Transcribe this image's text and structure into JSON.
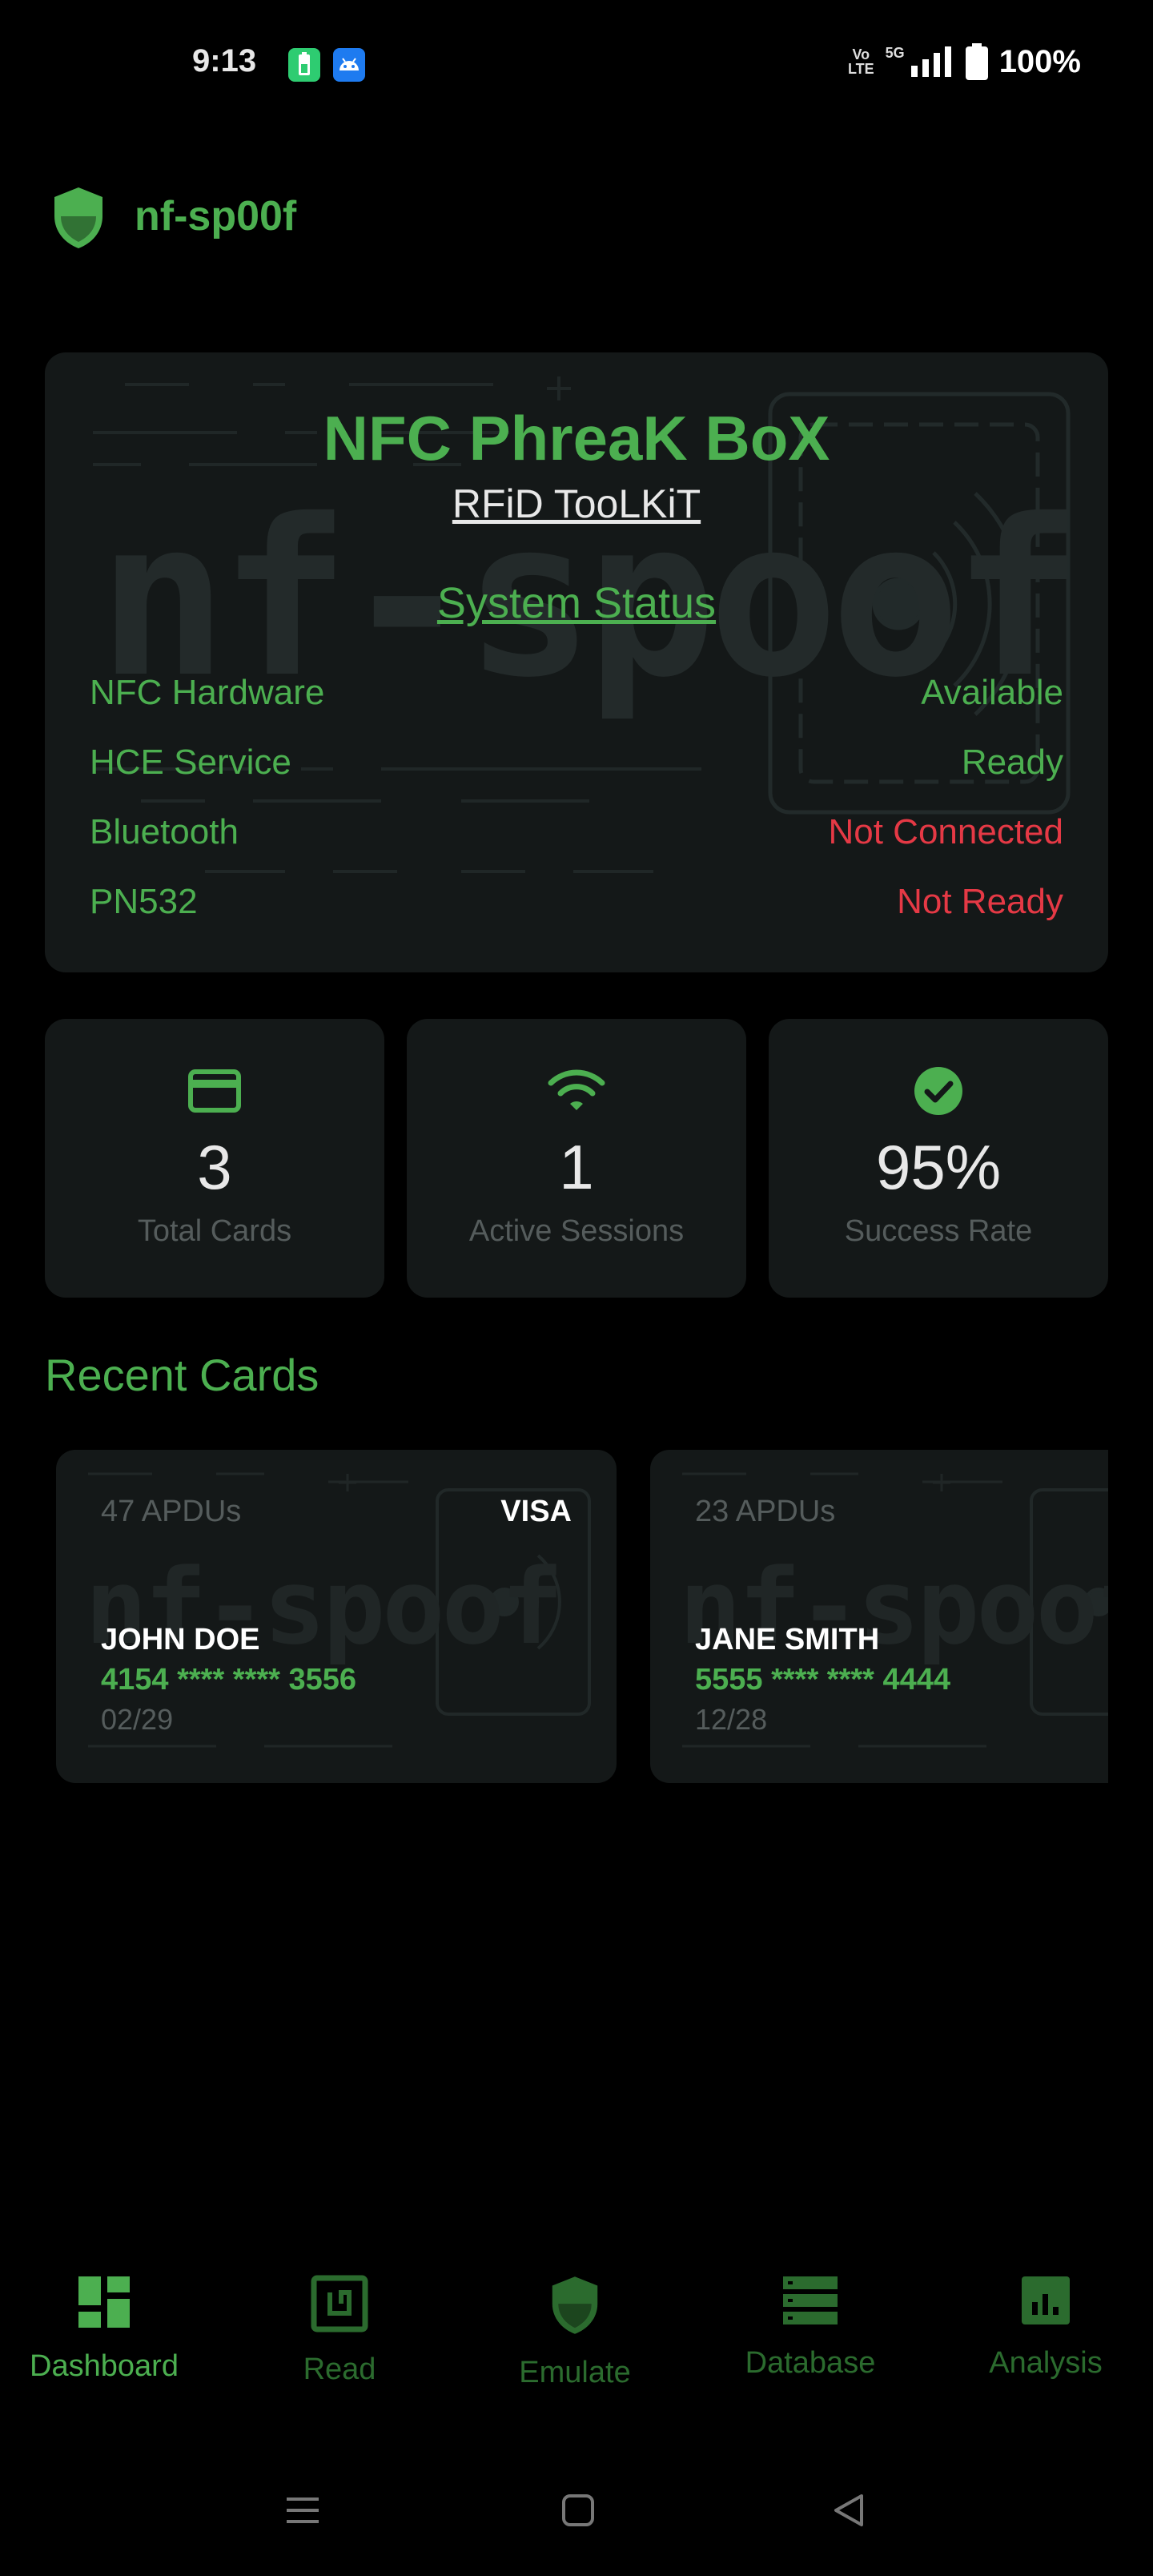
{
  "status_bar": {
    "time": "9:13",
    "volte_top": "Vo",
    "volte_bottom": "LTE",
    "network": "5G",
    "battery": "100%"
  },
  "app": {
    "title": "nf-sp00f",
    "watermark": "nf-spoof"
  },
  "hero": {
    "title": "NFC PhreaK BoX",
    "subtitle": "RFiD TooLKiT",
    "section_title": "System Status",
    "rows": [
      {
        "label": "NFC Hardware",
        "value": "Available",
        "state": "ok"
      },
      {
        "label": "HCE Service",
        "value": "Ready",
        "state": "ok"
      },
      {
        "label": "Bluetooth",
        "value": "Not Connected",
        "state": "bad"
      },
      {
        "label": "PN532",
        "value": "Not Ready",
        "state": "bad"
      }
    ]
  },
  "stats": [
    {
      "icon": "credit-card-icon",
      "value": "3",
      "label": "Total Cards"
    },
    {
      "icon": "wifi-icon",
      "value": "1",
      "label": "Active Sessions"
    },
    {
      "icon": "check-circle-icon",
      "value": "95%",
      "label": "Success Rate"
    }
  ],
  "recent": {
    "title": "Recent Cards",
    "cards": [
      {
        "apdus": "47 APDUs",
        "brand": "VISA",
        "name": "JOHN DOE",
        "number": "4154 **** **** 3556",
        "expiry": "02/29"
      },
      {
        "apdus": "23 APDUs",
        "brand": "",
        "name": "JANE SMITH",
        "number": "5555 **** **** 4444",
        "expiry": "12/28"
      }
    ]
  },
  "nav": {
    "items": [
      {
        "label": "Dashboard",
        "icon": "dashboard-icon",
        "active": true
      },
      {
        "label": "Read",
        "icon": "nfc-read-icon",
        "active": false
      },
      {
        "label": "Emulate",
        "icon": "shield-icon",
        "active": false
      },
      {
        "label": "Database",
        "icon": "database-icon",
        "active": false
      },
      {
        "label": "Analysis",
        "icon": "analytics-icon",
        "active": false
      }
    ]
  },
  "colors": {
    "accent": "#4caf50",
    "error": "#e53945",
    "card_bg": "#141818",
    "background": "#000000"
  }
}
